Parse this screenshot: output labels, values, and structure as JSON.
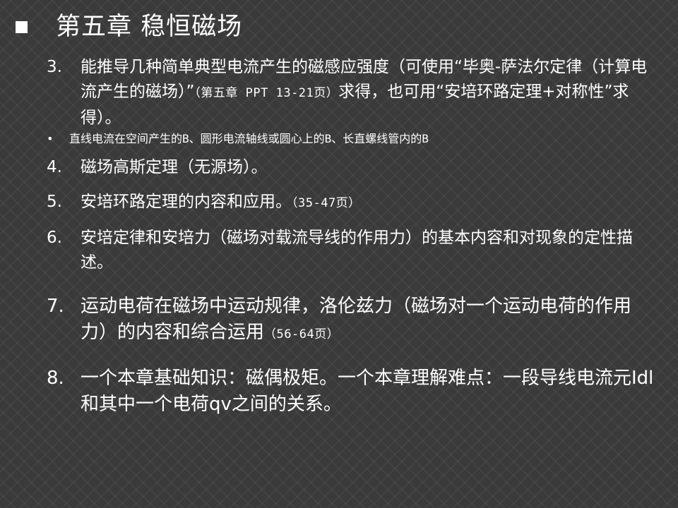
{
  "slide": {
    "title": "第五章 稳恒磁场",
    "items": [
      {
        "num": "3.",
        "text": "能推导几种简单典型电流产生的磁感应强度（可使用“毕奥-萨法尔定律（计算电流产生的磁场）”",
        "ref": "（第五章 PPT 13-21页）",
        "tail": "求得，也可用“安培环路定理+对称性”求得）。"
      },
      {
        "bullet": "•",
        "text": "直线电流在空间产生的B、圆形电流轴线或圆心上的B、长直螺线管内的B"
      },
      {
        "num": "4.",
        "text": "磁场高斯定理（无源场）。"
      },
      {
        "num": "5.",
        "text": "安培环路定理的内容和应用。",
        "ref": "（35-47页）"
      },
      {
        "num": "6.",
        "text": "安培定律和安培力（磁场对载流导线的作用力）的基本内容和对现象的定性描述。"
      },
      {
        "num": "7.",
        "text": "运动电荷在磁场中运动规律，洛伦兹力（磁场对一个运动电荷的作用力）的内容和综合运用",
        "ref": "（56-64页）"
      },
      {
        "num": "8.",
        "text": "一个本章基础知识：磁偶极矩。一个本章理解难点：一段导线电流元Idl和其中一个电荷qv之间的关系。"
      }
    ]
  }
}
